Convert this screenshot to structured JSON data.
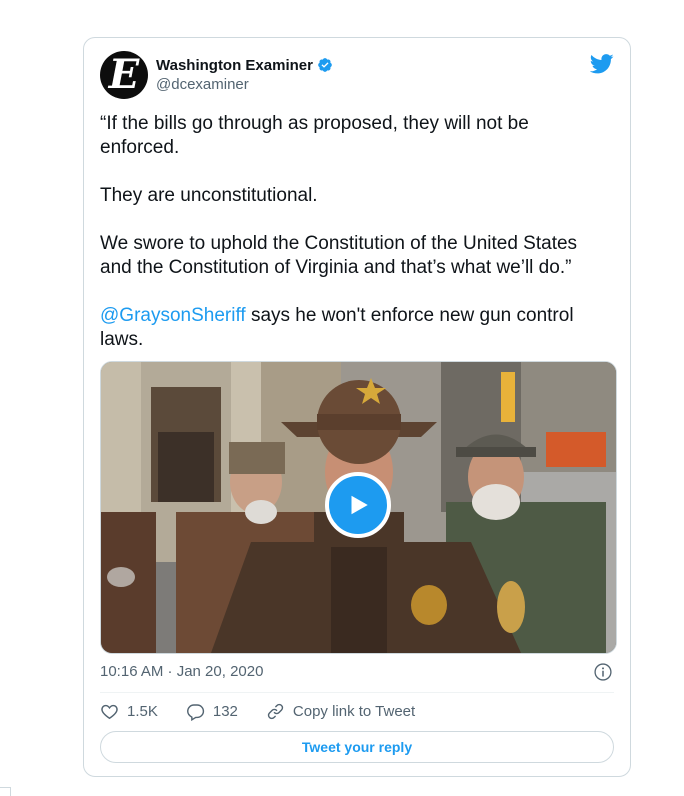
{
  "tweet": {
    "author_name": "Washington Examiner",
    "author_handle": "@dcexaminer",
    "avatar_letter": "E",
    "paragraphs": [
      "“If the bills go through as proposed, they will not be enforced.",
      "They are unconstitutional.",
      "We swore to uphold the Constitution of the United States and the Constitution of Virginia and that’s what we’ll do.”"
    ],
    "mention": "@GraysonSheriff",
    "mention_rest": " says he won't enforce new gun control laws.",
    "media_type": "video",
    "timestamp": "10:16 AM · Jan 20, 2020",
    "likes": "1.5K",
    "replies": "132",
    "copy_link_label": "Copy link to Tweet",
    "reply_button_label": "Tweet your reply"
  },
  "icons": [
    "twitter-bird-icon",
    "verified-badge-icon",
    "play-icon",
    "info-icon",
    "heart-icon",
    "reply-icon",
    "link-icon"
  ],
  "colors": {
    "accent": "#1d9bf0",
    "secondary_text": "#536471",
    "border": "#cfd9de"
  }
}
